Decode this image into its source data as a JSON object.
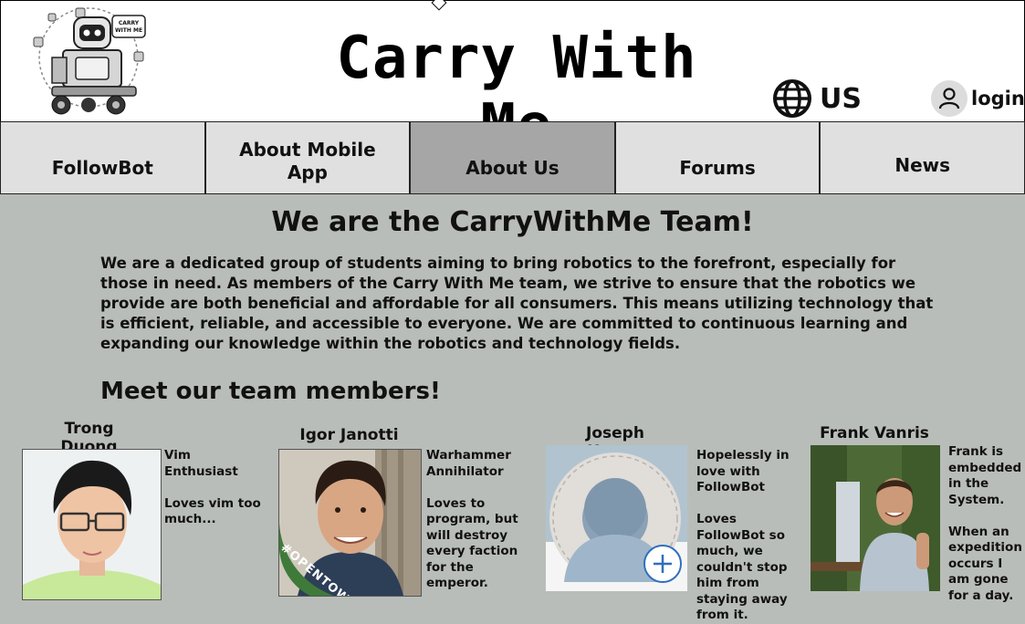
{
  "header": {
    "title": "Carry With Me",
    "logo_icon": "robot-carrier-logo-icon",
    "logo_bubble_text": "CARRY WITH ME",
    "region": {
      "icon": "globe-icon",
      "label": "US"
    },
    "login": {
      "icon": "user-icon",
      "label": "login"
    }
  },
  "nav": {
    "items": [
      {
        "label": "FollowBot"
      },
      {
        "label": "About Mobile App"
      },
      {
        "label": "About Us"
      },
      {
        "label": "Forums"
      },
      {
        "label": "News"
      }
    ],
    "active_index": 2
  },
  "main": {
    "heading": "We are the CarryWithMe Team!",
    "intro": "We are a dedicated group of students aiming to bring robotics to the forefront, especially for those in need. As members of the Carry With Me team, we strive to ensure that the robotics we provide are both beneficial and affordable for all consumers. This means utilizing technology that is efficient, reliable, and accessible to everyone. We are committed to continuous learning and expanding our knowledge within the robotics and technology fields.",
    "team_heading": "Meet our team members!"
  },
  "team": [
    {
      "name": "Trong Duong",
      "description": "Vim Enthusiast\n\nLoves vim too much..."
    },
    {
      "name": "Igor Janotti",
      "description": "Warhammer Annihilator\n\nLoves to program, but will destroy every faction for the emperor.",
      "badge": "#OPENTOWORK"
    },
    {
      "name": "Joseph Hoang",
      "description": "Hopelessly in love with FollowBot\n\nLoves FollowBot so much, we couldn't stop him from staying away from it."
    },
    {
      "name": "Frank Vanris",
      "description": "Frank is embedded in the System.\n\nWhen an expedition occurs I am gone for a day."
    }
  ],
  "colors": {
    "page_bg": "#b9bdb9",
    "nav_bg": "#e0e0e0",
    "nav_active_bg": "#a6a6a6",
    "header_bg": "#ffffff"
  }
}
